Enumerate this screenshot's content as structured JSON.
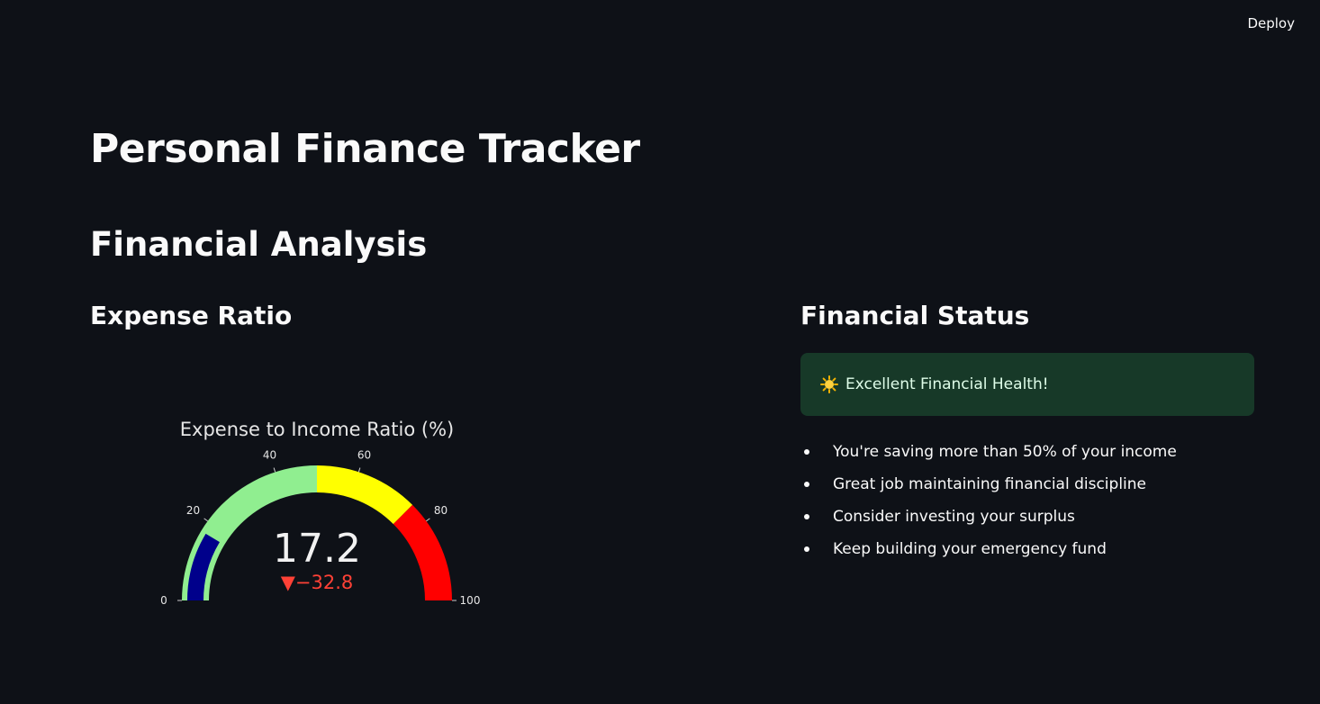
{
  "header": {
    "deploy_label": "Deploy"
  },
  "title": "Personal Finance Tracker",
  "section": "Financial Analysis",
  "left_column": {
    "subheader": "Expense Ratio"
  },
  "right_column": {
    "subheader": "Financial Status",
    "status_message": "Excellent Financial Health!",
    "status_icon": "sun-icon",
    "tips": [
      "You're saving more than 50% of your income",
      "Great job maintaining financial discipline",
      "Consider investing your surplus",
      "Keep building your emergency fund"
    ]
  },
  "chart_data": {
    "type": "gauge",
    "title": "Expense to Income Ratio (%)",
    "value": 17.2,
    "value_label": "17.2",
    "delta": -32.8,
    "delta_label": "▼−32.8",
    "range": [
      0,
      100
    ],
    "ticks": [
      0,
      20,
      40,
      60,
      80,
      100
    ],
    "tick_labels": [
      "0",
      "20",
      "40",
      "60",
      "80",
      "100"
    ],
    "steps": [
      {
        "range": [
          0,
          50
        ],
        "color": "#90ee90"
      },
      {
        "range": [
          50,
          75
        ],
        "color": "#ffff00"
      },
      {
        "range": [
          75,
          100
        ],
        "color": "#ff0000"
      }
    ],
    "bar_color": "#00008b",
    "delta_color": "#ff4136"
  }
}
